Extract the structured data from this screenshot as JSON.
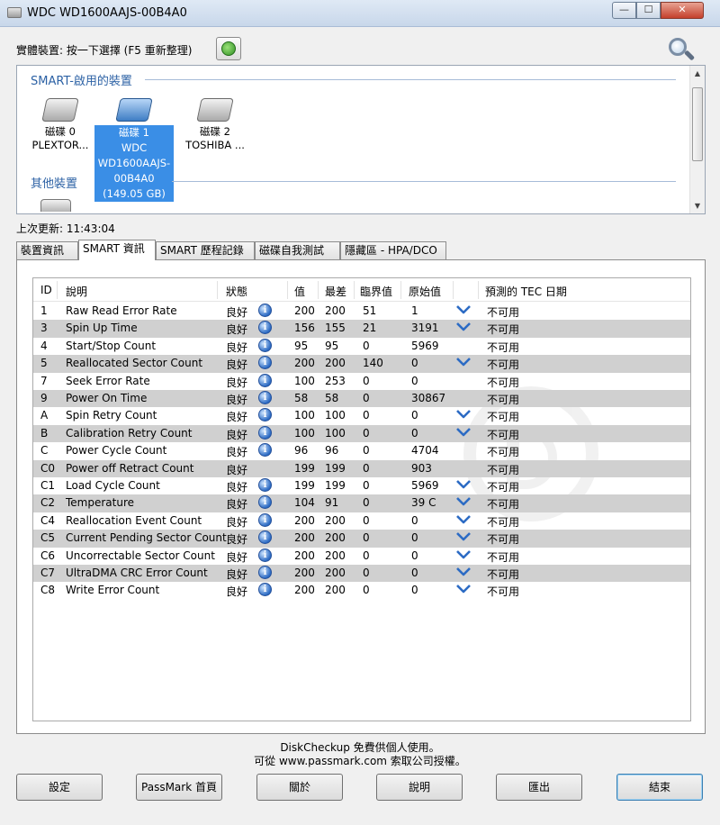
{
  "window": {
    "title": "WDC WD1600AAJS-00B4A0"
  },
  "toolbar": {
    "device_label": "實體裝置: 按一下選擇 (F5 重新整理)"
  },
  "devices": {
    "smart_section": "SMART-啟用的裝置",
    "other_section": "其他裝置",
    "disks": [
      {
        "lines": [
          "磁碟 0",
          "PLEXTOR..."
        ]
      },
      {
        "lines": [
          "磁碟 1",
          "WDC",
          "WD1600AAJS-",
          "00B4A0",
          "(149.05 GB)"
        ]
      },
      {
        "lines": [
          "磁碟 2",
          "TOSHIBA ..."
        ]
      }
    ]
  },
  "status": {
    "last_update": "上次更新: 11:43:04"
  },
  "tabs": [
    "裝置資訊",
    "SMART 資訊",
    "SMART 歷程記錄",
    "磁碟自我測試",
    "隱藏區 - HPA/DCO"
  ],
  "table": {
    "columns": [
      "ID",
      "說明",
      "狀態",
      "值",
      "最差",
      "臨界值",
      "原始值",
      "預測的 TEC 日期"
    ],
    "rows": [
      {
        "id": "1",
        "desc": "Raw Read Error Rate",
        "status": "良好",
        "info": true,
        "value": "200",
        "worst": "200",
        "threshold": "51",
        "raw": "1",
        "chevron": true,
        "tec": "不可用"
      },
      {
        "id": "3",
        "desc": "Spin Up Time",
        "status": "良好",
        "info": true,
        "value": "156",
        "worst": "155",
        "threshold": "21",
        "raw": "3191",
        "chevron": true,
        "tec": "不可用"
      },
      {
        "id": "4",
        "desc": "Start/Stop Count",
        "status": "良好",
        "info": true,
        "value": "95",
        "worst": "95",
        "threshold": "0",
        "raw": "5969",
        "chevron": false,
        "tec": "不可用"
      },
      {
        "id": "5",
        "desc": "Reallocated Sector Count",
        "status": "良好",
        "info": true,
        "value": "200",
        "worst": "200",
        "threshold": "140",
        "raw": "0",
        "chevron": true,
        "tec": "不可用"
      },
      {
        "id": "7",
        "desc": "Seek Error Rate",
        "status": "良好",
        "info": true,
        "value": "100",
        "worst": "253",
        "threshold": "0",
        "raw": "0",
        "chevron": false,
        "tec": "不可用"
      },
      {
        "id": "9",
        "desc": "Power On Time",
        "status": "良好",
        "info": true,
        "value": "58",
        "worst": "58",
        "threshold": "0",
        "raw": "30867",
        "chevron": false,
        "tec": "不可用"
      },
      {
        "id": "A",
        "desc": "Spin Retry Count",
        "status": "良好",
        "info": true,
        "value": "100",
        "worst": "100",
        "threshold": "0",
        "raw": "0",
        "chevron": true,
        "tec": "不可用"
      },
      {
        "id": "B",
        "desc": "Calibration Retry Count",
        "status": "良好",
        "info": true,
        "value": "100",
        "worst": "100",
        "threshold": "0",
        "raw": "0",
        "chevron": true,
        "tec": "不可用"
      },
      {
        "id": "C",
        "desc": "Power Cycle Count",
        "status": "良好",
        "info": true,
        "value": "96",
        "worst": "96",
        "threshold": "0",
        "raw": "4704",
        "chevron": false,
        "tec": "不可用"
      },
      {
        "id": "C0",
        "desc": "Power off Retract Count",
        "status": "良好",
        "info": false,
        "value": "199",
        "worst": "199",
        "threshold": "0",
        "raw": "903",
        "chevron": false,
        "tec": "不可用"
      },
      {
        "id": "C1",
        "desc": "Load Cycle Count",
        "status": "良好",
        "info": true,
        "value": "199",
        "worst": "199",
        "threshold": "0",
        "raw": "5969",
        "chevron": true,
        "tec": "不可用"
      },
      {
        "id": "C2",
        "desc": "Temperature",
        "status": "良好",
        "info": true,
        "value": "104",
        "worst": "91",
        "threshold": "0",
        "raw": "39 C",
        "chevron": true,
        "tec": "不可用"
      },
      {
        "id": "C4",
        "desc": "Reallocation Event Count",
        "status": "良好",
        "info": true,
        "value": "200",
        "worst": "200",
        "threshold": "0",
        "raw": "0",
        "chevron": true,
        "tec": "不可用"
      },
      {
        "id": "C5",
        "desc": "Current Pending Sector Count",
        "status": "良好",
        "info": true,
        "value": "200",
        "worst": "200",
        "threshold": "0",
        "raw": "0",
        "chevron": true,
        "tec": "不可用"
      },
      {
        "id": "C6",
        "desc": "Uncorrectable Sector Count",
        "status": "良好",
        "info": true,
        "value": "200",
        "worst": "200",
        "threshold": "0",
        "raw": "0",
        "chevron": true,
        "tec": "不可用"
      },
      {
        "id": "C7",
        "desc": "UltraDMA CRC Error Count",
        "status": "良好",
        "info": true,
        "value": "200",
        "worst": "200",
        "threshold": "0",
        "raw": "0",
        "chevron": true,
        "tec": "不可用"
      },
      {
        "id": "C8",
        "desc": "Write Error Count",
        "status": "良好",
        "info": true,
        "value": "200",
        "worst": "200",
        "threshold": "0",
        "raw": "0",
        "chevron": true,
        "tec": "不可用"
      }
    ]
  },
  "footer": {
    "line1": "DiskCheckup 免費供個人使用。",
    "line2": "可從 www.passmark.com 索取公司授權。"
  },
  "buttons": {
    "settings": "設定",
    "passmark": "PassMark 首頁",
    "about": "關於",
    "help": "說明",
    "export": "匯出",
    "exit": "結束"
  },
  "colors": {
    "selection": "#3a8ee6",
    "alt_row": "#d0d0d0",
    "section_title": "#2d62a5",
    "icon_blue": "#2c6bc4"
  }
}
